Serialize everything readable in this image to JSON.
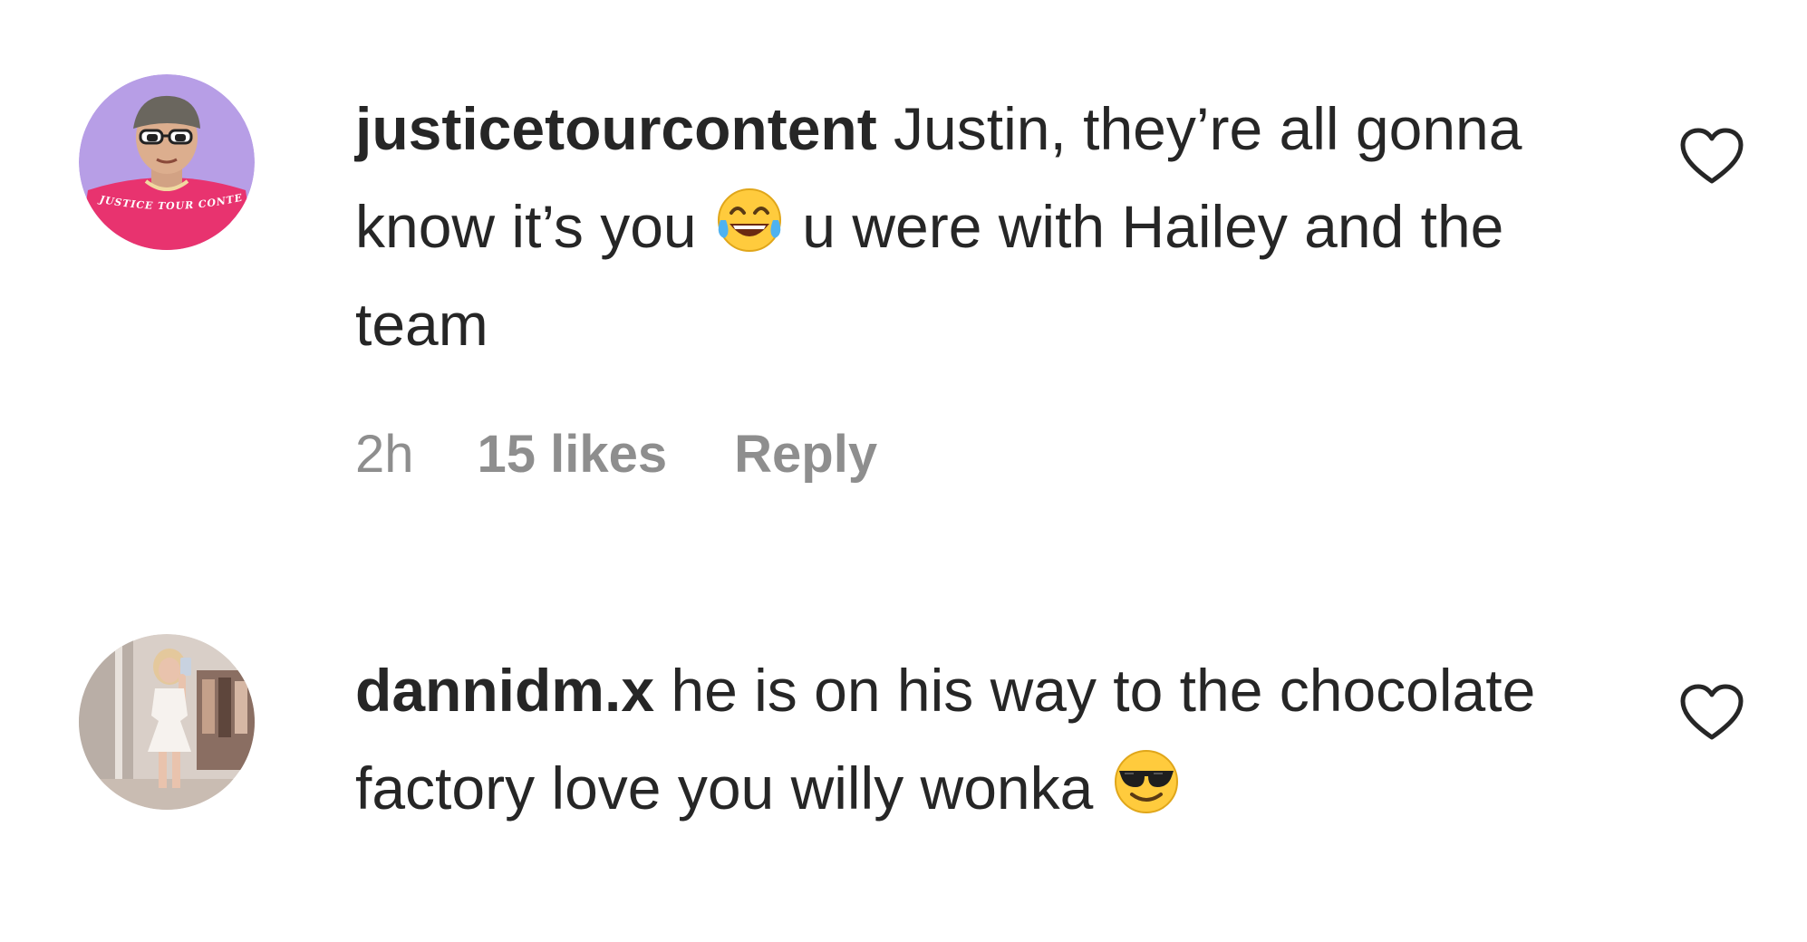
{
  "comments": [
    {
      "username": "justicetourcontent",
      "text_before_emoji": " Justin, they’re all gonna know it’s you ",
      "emoji_icon": "face-with-tears-of-joy-emoji",
      "text_after_emoji": " u were with Hailey and the team",
      "time": "2h",
      "likes": "15 likes",
      "reply_label": "Reply",
      "avatar_text": "JUSTICE TOUR CONTENT",
      "avatar_bg": "#b79ee6",
      "avatar_shirt": "#e8336f"
    },
    {
      "username": "dannidm.x",
      "text_before_emoji": " he is on his way to the chocolate factory love you willy wonka ",
      "emoji_icon": "smiling-face-with-sunglasses-emoji",
      "avatar_bg": "#d9cfc8"
    }
  ],
  "icons": {
    "like": "heart-outline-icon"
  },
  "colors": {
    "text": "#262626",
    "meta": "#8e8e8e"
  }
}
